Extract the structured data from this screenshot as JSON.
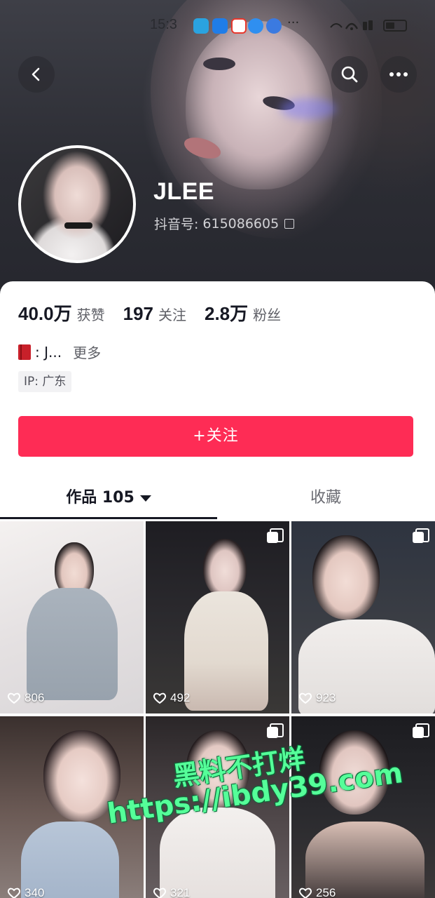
{
  "status_bar": {
    "time": "15:3"
  },
  "profile": {
    "name": "JLEE",
    "douyin_id_label": "抖音号:",
    "douyin_id": "615086605"
  },
  "stats": [
    {
      "value": "40.0万",
      "label": "获赞"
    },
    {
      "value": "197",
      "label": "关注"
    },
    {
      "value": "2.8万",
      "label": "粉丝"
    }
  ],
  "bio": {
    "text": ": J...",
    "more": "更多"
  },
  "ip_tag": "IP:  广东",
  "follow_button": "+关注",
  "tabs": {
    "works": "作品 105",
    "favorites": "收藏"
  },
  "videos": [
    {
      "likes": "806",
      "multi_image": false
    },
    {
      "likes": "492",
      "multi_image": true
    },
    {
      "likes": "923",
      "multi_image": true
    },
    {
      "likes": "340",
      "multi_image": false
    },
    {
      "likes": "321",
      "multi_image": true
    },
    {
      "likes": "256",
      "multi_image": true
    }
  ],
  "watermark": {
    "line1": "黑料不打烊",
    "line2": "https://ibdy39.com"
  },
  "colors": {
    "accent": "#fe2c55",
    "text_primary": "#161823",
    "text_secondary": "#5e5f66",
    "watermark": "#55ff99"
  },
  "icons": [
    "back-icon",
    "search-icon",
    "more-icon",
    "copy-icon",
    "book-icon",
    "heart-icon",
    "multi-image-icon",
    "caret-down-icon"
  ]
}
